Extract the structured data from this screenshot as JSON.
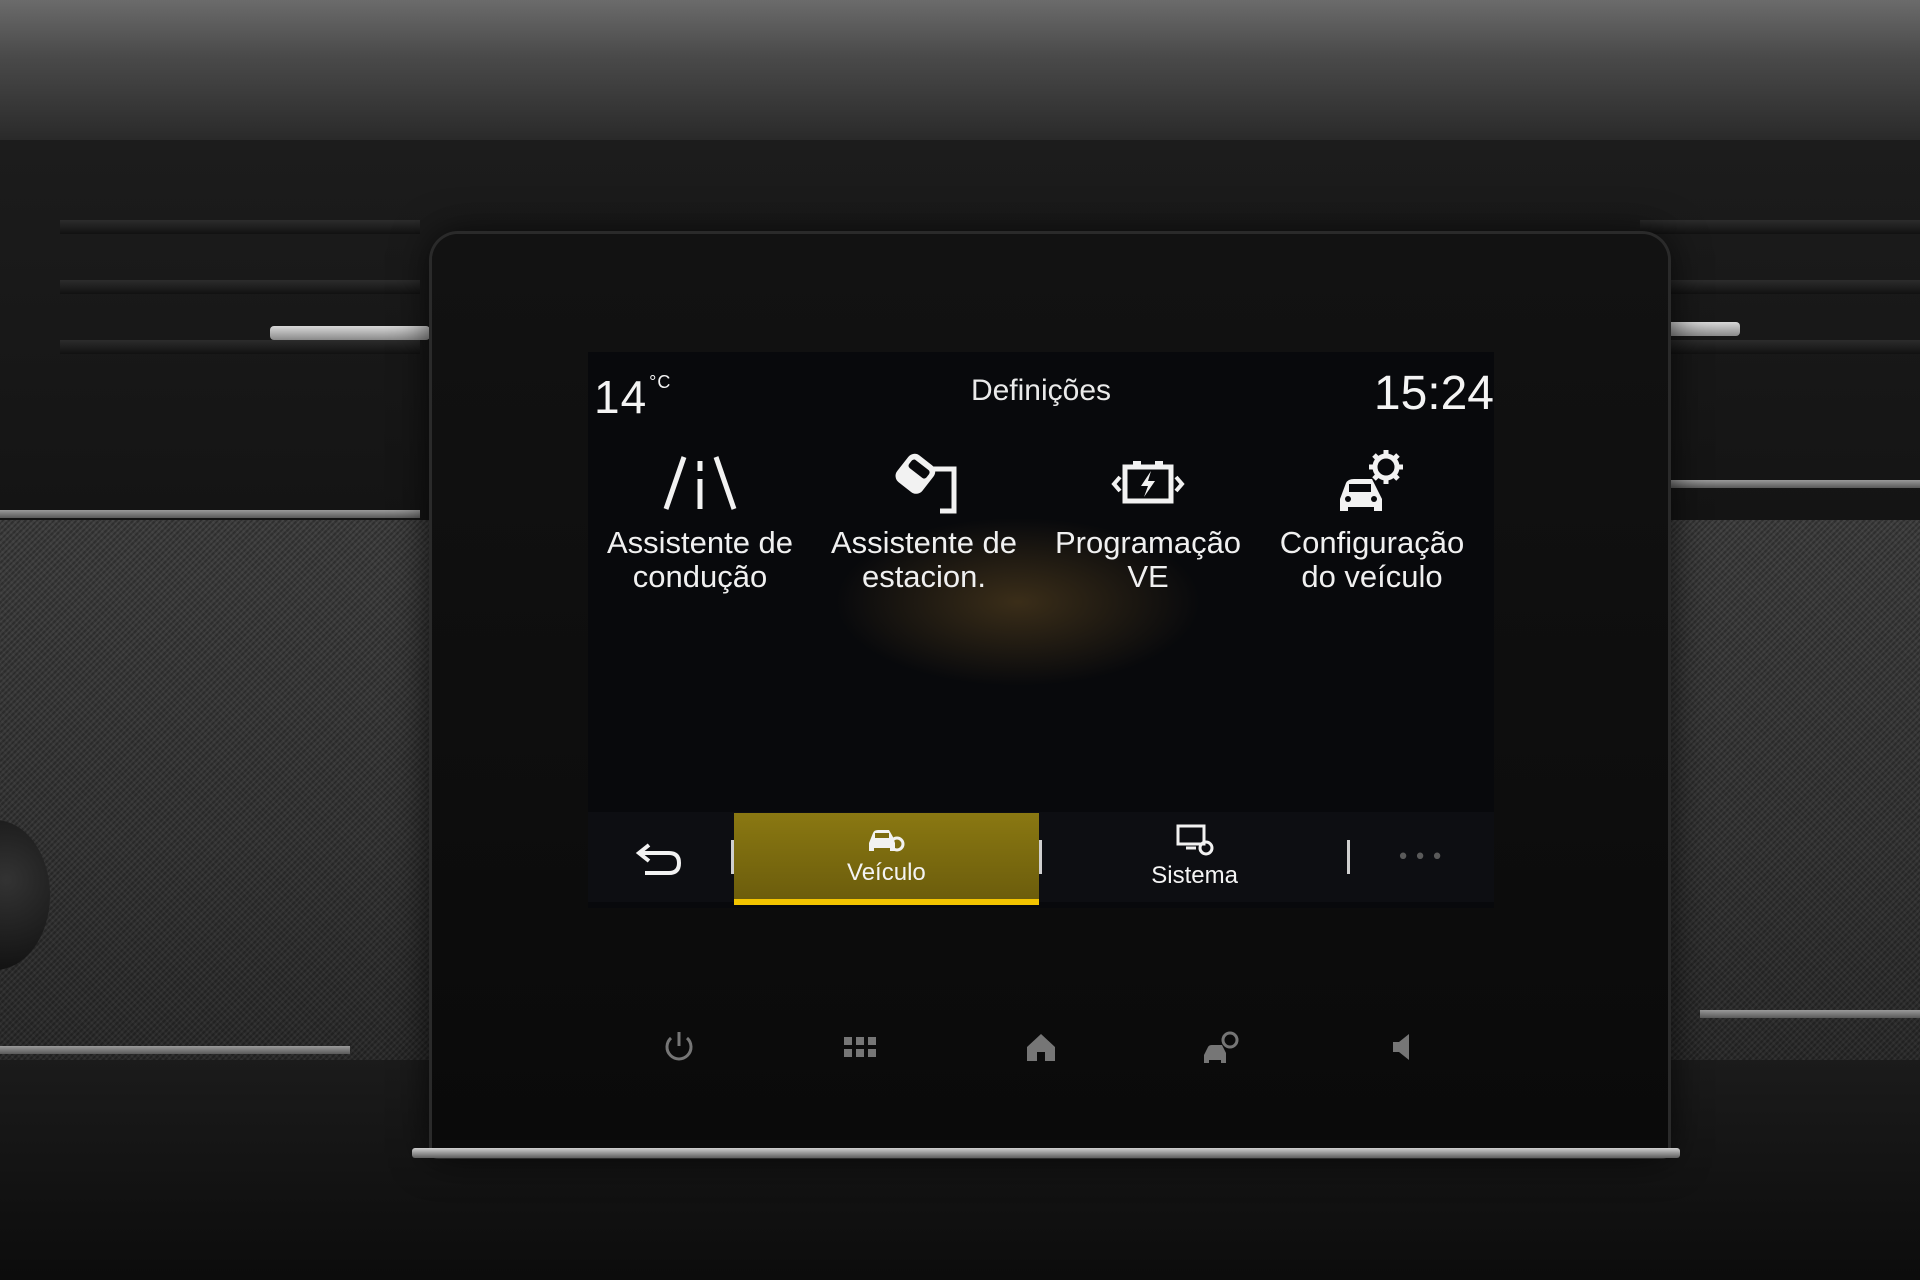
{
  "status": {
    "temperature": "14",
    "temperature_unit": "°C",
    "title": "Definições",
    "clock": "15:24"
  },
  "tiles": [
    {
      "label": "Assistente de\ncondução",
      "icon": "lane-assist-icon"
    },
    {
      "label": "Assistente de\nestacion.",
      "icon": "parking-assist-icon"
    },
    {
      "label": "Programação\nVE",
      "icon": "ev-battery-icon"
    },
    {
      "label": "Configuração\ndo veículo",
      "icon": "car-settings-icon"
    }
  ],
  "tabbar": {
    "back_icon": "back-arrow-icon",
    "tabs": [
      {
        "label": "Veículo",
        "icon": "car-gear-icon",
        "active": true
      },
      {
        "label": "Sistema",
        "icon": "display-gear-icon",
        "active": false
      }
    ],
    "more_label": "•••"
  },
  "hardware_buttons": [
    {
      "icon": "power-icon"
    },
    {
      "icon": "apps-grid-icon"
    },
    {
      "icon": "home-icon"
    },
    {
      "icon": "car-settings-icon"
    },
    {
      "icon": "volume-icon"
    }
  ],
  "colors": {
    "accent": "#f2c400",
    "active_tab_bg": "#7d6c10",
    "screen_bg": "#08090c"
  }
}
